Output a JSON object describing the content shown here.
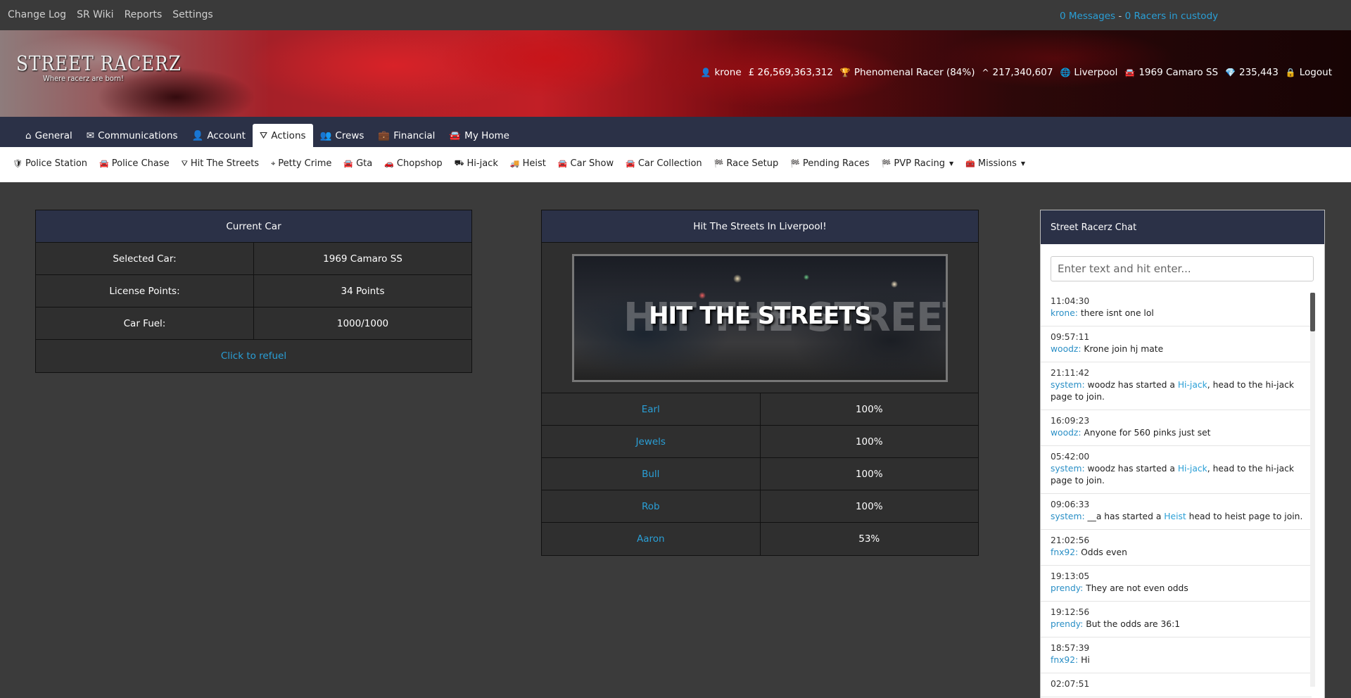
{
  "topbar": {
    "links": [
      "Change Log",
      "SR Wiki",
      "Reports",
      "Settings"
    ],
    "messages_link": "0 Messages",
    "separator": " - ",
    "custody_link": "0 Racers in custody"
  },
  "logo": {
    "title": "STREET RACERZ",
    "tagline": "Where racerz are born!"
  },
  "stats": {
    "username": "krone",
    "money": "£ 26,569,363,312",
    "rank": "Phenomenal Racer (84%)",
    "points": "217,340,607",
    "location": "Liverpool",
    "car": "1969 Camaro SS",
    "diamonds": "235,443",
    "logout": "Logout"
  },
  "mainnav": {
    "tabs": [
      {
        "label": "General",
        "icon": "home-icon"
      },
      {
        "label": "Communications",
        "icon": "envelope-icon"
      },
      {
        "label": "Account",
        "icon": "user-icon"
      },
      {
        "label": "Actions",
        "icon": "road-icon",
        "active": true
      },
      {
        "label": "Crews",
        "icon": "users-icon"
      },
      {
        "label": "Financial",
        "icon": "briefcase-icon"
      },
      {
        "label": "My Home",
        "icon": "car-icon"
      }
    ]
  },
  "subnav": {
    "items": [
      {
        "label": "Police Station",
        "icon": "shield-icon"
      },
      {
        "label": "Police Chase",
        "icon": "car-icon"
      },
      {
        "label": "Hit The Streets",
        "icon": "road-icon"
      },
      {
        "label": "Petty Crime",
        "icon": "crosshairs-icon"
      },
      {
        "label": "Gta",
        "icon": "car-icon"
      },
      {
        "label": "Chopshop",
        "icon": "car-crash-icon"
      },
      {
        "label": "Hi-jack",
        "icon": "truck-loading-icon"
      },
      {
        "label": "Heist",
        "icon": "truck-icon"
      },
      {
        "label": "Car Show",
        "icon": "car-icon"
      },
      {
        "label": "Car Collection",
        "icon": "car-icon"
      },
      {
        "label": "Race Setup",
        "icon": "flag-checkered-icon"
      },
      {
        "label": "Pending Races",
        "icon": "flag-checkered-icon"
      },
      {
        "label": "PVP Racing",
        "icon": "flag-checkered-icon",
        "dropdown": true
      },
      {
        "label": "Missions",
        "icon": "toolbox-icon",
        "dropdown": true
      }
    ]
  },
  "current_car": {
    "header": "Current Car",
    "rows": [
      {
        "label": "Selected Car:",
        "value": "1969 Camaro SS"
      },
      {
        "label": "License Points:",
        "value": "34 Points"
      },
      {
        "label": "Car Fuel:",
        "value": "1000/1000"
      }
    ],
    "refuel_link": "Click to refuel"
  },
  "streets": {
    "header": "Hit The Streets In Liverpool!",
    "image_title": "HIT THE STREETS",
    "image_ghost": "HIT THE STREETS",
    "rows": [
      {
        "name": "Earl",
        "value": "100%"
      },
      {
        "name": "Jewels",
        "value": "100%"
      },
      {
        "name": "Bull",
        "value": "100%"
      },
      {
        "name": "Rob",
        "value": "100%"
      },
      {
        "name": "Aaron",
        "value": "53%"
      }
    ]
  },
  "chat": {
    "header": "Street Racerz Chat",
    "placeholder": "Enter text and hit enter...",
    "messages": [
      {
        "time": "11:04:30",
        "user": "krone:",
        "text": " there isnt one lol"
      },
      {
        "time": "09:57:11",
        "user": "woodz:",
        "text": " Krone join hj mate"
      },
      {
        "time": "21:11:42",
        "user": "system:",
        "pre": " woodz has started a ",
        "link": "Hi-jack",
        "post": ", head to the hi-jack page to join."
      },
      {
        "time": "16:09:23",
        "user": "woodz:",
        "text": " Anyone for 560 pinks just set"
      },
      {
        "time": "05:42:00",
        "user": "system:",
        "pre": " woodz has started a ",
        "link": "Hi-jack",
        "post": ", head to the hi-jack page to join."
      },
      {
        "time": "09:06:33",
        "user": "system:",
        "pre": " __a has started a ",
        "link": "Heist",
        "post": " head to heist page to join."
      },
      {
        "time": "21:02:56",
        "user": "fnx92:",
        "text": " Odds even"
      },
      {
        "time": "19:13:05",
        "user": "prendy:",
        "text": " They are not even odds"
      },
      {
        "time": "19:12:56",
        "user": "prendy:",
        "text": " But the odds are 36:1"
      },
      {
        "time": "18:57:39",
        "user": "fnx92:",
        "text": " Hi"
      },
      {
        "time": "02:07:51",
        "user": "",
        "text": ""
      }
    ]
  },
  "colors": {
    "accent": "#2a9fd6",
    "nav_bg": "#2b3147",
    "page_bg": "#3b3b3b"
  }
}
